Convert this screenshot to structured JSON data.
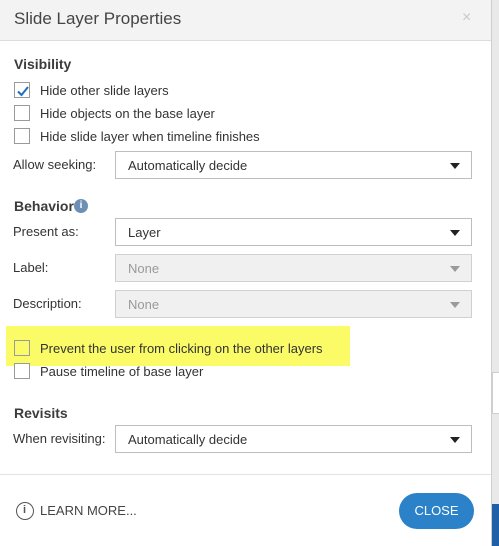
{
  "dialog": {
    "title": "Slide Layer Properties",
    "close_symbol": "×"
  },
  "visibility": {
    "heading": "Visibility",
    "options": [
      {
        "label": "Hide other slide layers",
        "checked": true
      },
      {
        "label": "Hide objects on the base layer",
        "checked": false
      },
      {
        "label": "Hide slide layer when timeline finishes",
        "checked": false
      }
    ],
    "allow_seeking": {
      "label": "Allow seeking:",
      "value": "Automatically decide"
    }
  },
  "behavior": {
    "heading": "Behavior",
    "info_icon": "info-icon",
    "present_as": {
      "label": "Present as:",
      "value": "Layer"
    },
    "label_field": {
      "label": "Label:",
      "value": "None",
      "disabled": true
    },
    "description_field": {
      "label": "Description:",
      "value": "None",
      "disabled": true
    },
    "options": [
      {
        "label": "Prevent the user from clicking on the other layers",
        "checked": false,
        "highlighted": true
      },
      {
        "label": "Pause timeline of base layer",
        "checked": false
      }
    ],
    "highlight_color": "#fbfb68"
  },
  "revisits": {
    "heading": "Revisits",
    "when_revisiting": {
      "label": "When revisiting:",
      "value": "Automatically decide"
    }
  },
  "footer": {
    "learn_more_icon": "info-circle-icon",
    "learn_more_glyph": "i",
    "learn_more": "LEARN MORE...",
    "close": "CLOSE"
  },
  "colors": {
    "accent": "#2b82c9",
    "checkmark": "#1f6fc0"
  }
}
